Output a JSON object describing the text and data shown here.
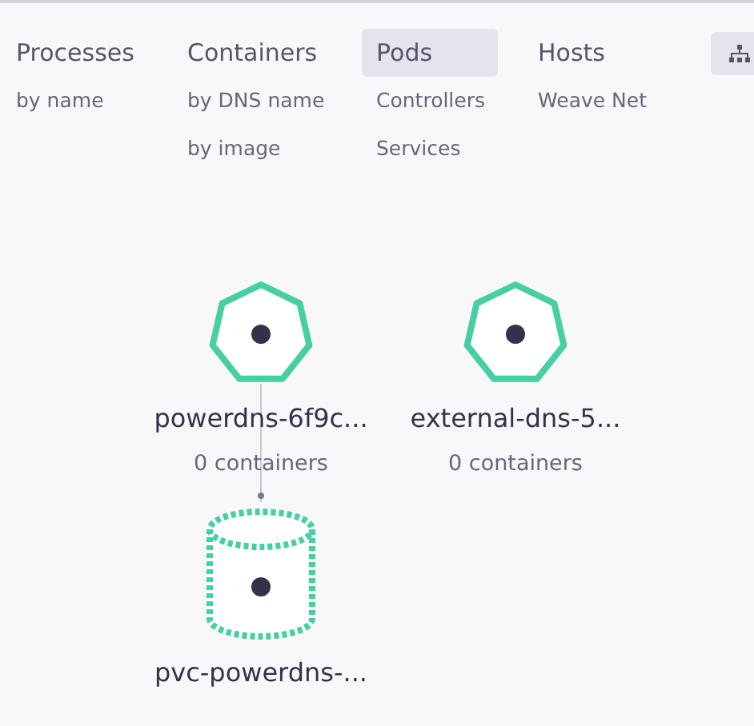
{
  "nav": [
    {
      "label": "Processes",
      "selected": false,
      "subitems": [
        "by name"
      ]
    },
    {
      "label": "Containers",
      "selected": false,
      "subitems": [
        "by DNS name",
        "by image"
      ]
    },
    {
      "label": "Pods",
      "selected": true,
      "subitems": [
        "Controllers",
        "Services"
      ]
    },
    {
      "label": "Hosts",
      "selected": false,
      "subitems": [
        "Weave Net"
      ]
    }
  ],
  "graph": {
    "nodes": [
      {
        "kind": "pod",
        "label": "powerdns-6f9c...",
        "subtitle": "0 containers"
      },
      {
        "kind": "pod",
        "label": "external-dns-5...",
        "subtitle": "0 containers"
      },
      {
        "kind": "volume",
        "label": "pvc-powerdns-..."
      }
    ]
  }
}
